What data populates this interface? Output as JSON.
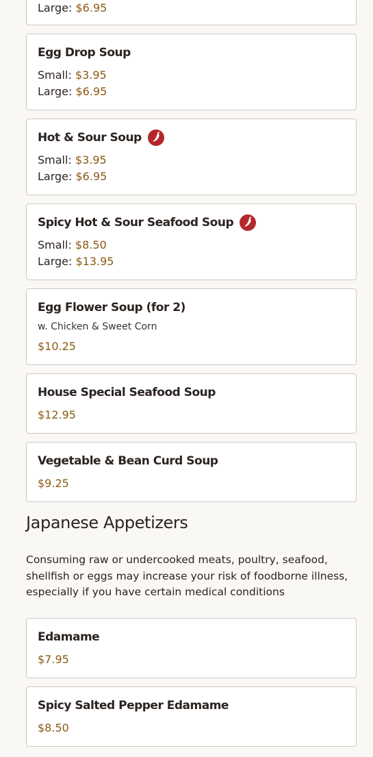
{
  "soups": [
    {
      "name": "",
      "prices": [
        {
          "size": "Large:",
          "price": "$6.95"
        }
      ],
      "partial": true
    },
    {
      "name": "Egg Drop Soup",
      "spicy": false,
      "prices": [
        {
          "size": "Small:",
          "price": "$3.95"
        },
        {
          "size": "Large:",
          "price": "$6.95"
        }
      ]
    },
    {
      "name": "Hot & Sour Soup",
      "spicy": true,
      "prices": [
        {
          "size": "Small:",
          "price": "$3.95"
        },
        {
          "size": "Large:",
          "price": "$6.95"
        }
      ]
    },
    {
      "name": "Spicy Hot & Sour Seafood Soup",
      "spicy": true,
      "prices": [
        {
          "size": "Small:",
          "price": "$8.50"
        },
        {
          "size": "Large:",
          "price": "$13.95"
        }
      ]
    },
    {
      "name": "Egg Flower Soup (for 2)",
      "spicy": false,
      "description": "w. Chicken & Sweet Corn",
      "price": "$10.25"
    },
    {
      "name": "House Special Seafood Soup",
      "spicy": false,
      "price": "$12.95"
    },
    {
      "name": "Vegetable & Bean Curd Soup",
      "spicy": false,
      "price": "$9.25"
    }
  ],
  "japanese_section": {
    "title": "Japanese Appetizers",
    "notice": "Consuming raw or undercooked meats, poultry, seafood, shellfish or eggs may increase your risk of foodborne illness, especially if you have certain medical conditions",
    "items": [
      {
        "name": "Edamame",
        "price": "$7.95"
      },
      {
        "name": "Spicy Salted Pepper Edamame",
        "price": "$8.50"
      }
    ]
  },
  "icons": {
    "spicy": "chili-pepper-icon"
  },
  "colors": {
    "price": "#8a5a12",
    "spicy": "#b4272a",
    "border": "#cfc8c3",
    "background": "#faf8f5"
  }
}
